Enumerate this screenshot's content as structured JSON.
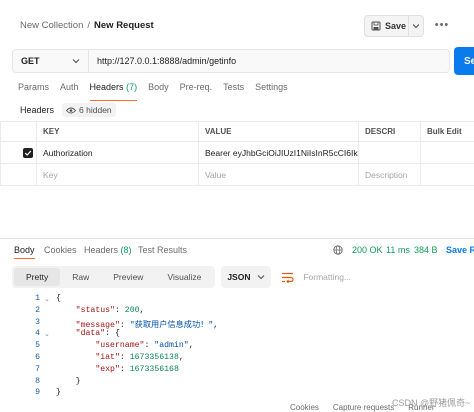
{
  "breadcrumb": {
    "collection": "New Collection",
    "separator": "/",
    "request": "New Request"
  },
  "toolbar": {
    "save_label": "Save"
  },
  "request": {
    "method": "GET",
    "url": "http://127.0.0.1:8888/admin/getinfo",
    "send_label": "Se"
  },
  "request_tabs": [
    {
      "label": "Params"
    },
    {
      "label": "Auth"
    },
    {
      "label": "Headers",
      "count": "(7)"
    },
    {
      "label": "Body"
    },
    {
      "label": "Pre-req."
    },
    {
      "label": "Tests"
    },
    {
      "label": "Settings"
    }
  ],
  "headers_section": {
    "title": "Headers",
    "hidden_label": "6 hidden"
  },
  "headers_table": {
    "columns": [
      "KEY",
      "VALUE",
      "DESCRI",
      "Bulk Edit"
    ],
    "rows": [
      {
        "checked": true,
        "key": "Authorization",
        "value": "Bearer eyJhbGciOiJIUzI1NiIsInR5cCI6Ik...",
        "description": ""
      }
    ],
    "placeholder": {
      "key": "Key",
      "value": "Value",
      "description": "Description"
    }
  },
  "response_tabs": [
    {
      "label": "Body"
    },
    {
      "label": "Cookies"
    },
    {
      "label": "Headers",
      "count": "(8)"
    },
    {
      "label": "Test Results"
    }
  ],
  "response_meta": {
    "status": "200 OK",
    "time": "11 ms",
    "size": "384 B",
    "save_label": "Save R"
  },
  "format_options": [
    "Pretty",
    "Raw",
    "Preview",
    "Visualize"
  ],
  "format_selected": "Pretty",
  "language": "JSON",
  "formatting_label": "Formatting...",
  "code_lines": [
    {
      "n": "1",
      "fold": true,
      "parts": [
        {
          "t": "{",
          "c": "p"
        }
      ]
    },
    {
      "n": "2",
      "parts": [
        {
          "t": "    ",
          "c": "p"
        },
        {
          "t": "\"status\"",
          "c": "k"
        },
        {
          "t": ": ",
          "c": "p"
        },
        {
          "t": "200",
          "c": "n"
        },
        {
          "t": ",",
          "c": "p"
        }
      ]
    },
    {
      "n": "3",
      "parts": [
        {
          "t": "    ",
          "c": "p"
        },
        {
          "t": "\"message\"",
          "c": "k"
        },
        {
          "t": ": ",
          "c": "p"
        },
        {
          "t": "\"获取用户信息成功！\"",
          "c": "s"
        },
        {
          "t": ",",
          "c": "p"
        }
      ]
    },
    {
      "n": "4",
      "fold": true,
      "parts": [
        {
          "t": "    ",
          "c": "p"
        },
        {
          "t": "\"data\"",
          "c": "k"
        },
        {
          "t": ": {",
          "c": "p"
        }
      ]
    },
    {
      "n": "5",
      "parts": [
        {
          "t": "        ",
          "c": "p"
        },
        {
          "t": "\"username\"",
          "c": "k"
        },
        {
          "t": ": ",
          "c": "p"
        },
        {
          "t": "\"admin\"",
          "c": "s"
        },
        {
          "t": ",",
          "c": "p"
        }
      ]
    },
    {
      "n": "6",
      "parts": [
        {
          "t": "        ",
          "c": "p"
        },
        {
          "t": "\"iat\"",
          "c": "k"
        },
        {
          "t": ": ",
          "c": "p"
        },
        {
          "t": "1673356138",
          "c": "n"
        },
        {
          "t": ",",
          "c": "p"
        }
      ]
    },
    {
      "n": "7",
      "parts": [
        {
          "t": "        ",
          "c": "p"
        },
        {
          "t": "\"exp\"",
          "c": "k"
        },
        {
          "t": ": ",
          "c": "p"
        },
        {
          "t": "1673356168",
          "c": "n"
        }
      ]
    },
    {
      "n": "8",
      "parts": [
        {
          "t": "    }",
          "c": "p"
        }
      ]
    },
    {
      "n": "9",
      "parts": [
        {
          "t": "}",
          "c": "p"
        }
      ]
    }
  ],
  "footer": {
    "cookies": "Cookies",
    "capture": "Capture requests",
    "runner": "Runner"
  },
  "watermark": "CSDN @野猪佩奇~"
}
